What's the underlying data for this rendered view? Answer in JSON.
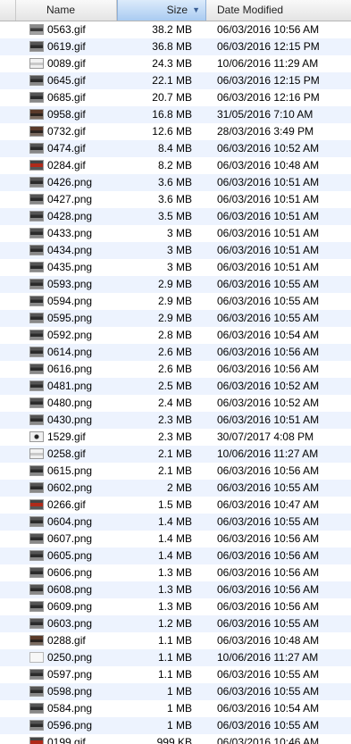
{
  "columns": {
    "name": "Name",
    "size": "Size",
    "date": "Date Modified",
    "sort_indicator": "▼"
  },
  "files": [
    {
      "name": "0563.gif",
      "size": "38.2 MB",
      "date": "06/03/2016 10:56 AM",
      "thumb": "mid"
    },
    {
      "name": "0619.gif",
      "size": "36.8 MB",
      "date": "06/03/2016 12:15 PM",
      "thumb": "dark"
    },
    {
      "name": "0089.gif",
      "size": "24.3 MB",
      "date": "10/06/2016 11:29 AM",
      "thumb": "light"
    },
    {
      "name": "0645.gif",
      "size": "22.1 MB",
      "date": "06/03/2016 12:15 PM",
      "thumb": "dark"
    },
    {
      "name": "0685.gif",
      "size": "20.7 MB",
      "date": "06/03/2016 12:16 PM",
      "thumb": "dark"
    },
    {
      "name": "0958.gif",
      "size": "16.8 MB",
      "date": "31/05/2016 7:10 AM",
      "thumb": "brown"
    },
    {
      "name": "0732.gif",
      "size": "12.6 MB",
      "date": "28/03/2016 3:49 PM",
      "thumb": "brown"
    },
    {
      "name": "0474.gif",
      "size": "8.4 MB",
      "date": "06/03/2016 10:52 AM",
      "thumb": "dark"
    },
    {
      "name": "0284.gif",
      "size": "8.2 MB",
      "date": "06/03/2016 10:48 AM",
      "thumb": "red"
    },
    {
      "name": "0426.png",
      "size": "3.6 MB",
      "date": "06/03/2016 10:51 AM",
      "thumb": "dark"
    },
    {
      "name": "0427.png",
      "size": "3.6 MB",
      "date": "06/03/2016 10:51 AM",
      "thumb": "dark"
    },
    {
      "name": "0428.png",
      "size": "3.5 MB",
      "date": "06/03/2016 10:51 AM",
      "thumb": "dark"
    },
    {
      "name": "0433.png",
      "size": "3 MB",
      "date": "06/03/2016 10:51 AM",
      "thumb": "dark"
    },
    {
      "name": "0434.png",
      "size": "3 MB",
      "date": "06/03/2016 10:51 AM",
      "thumb": "dark"
    },
    {
      "name": "0435.png",
      "size": "3 MB",
      "date": "06/03/2016 10:51 AM",
      "thumb": "dark"
    },
    {
      "name": "0593.png",
      "size": "2.9 MB",
      "date": "06/03/2016 10:55 AM",
      "thumb": "dark"
    },
    {
      "name": "0594.png",
      "size": "2.9 MB",
      "date": "06/03/2016 10:55 AM",
      "thumb": "dark"
    },
    {
      "name": "0595.png",
      "size": "2.9 MB",
      "date": "06/03/2016 10:55 AM",
      "thumb": "dark"
    },
    {
      "name": "0592.png",
      "size": "2.8 MB",
      "date": "06/03/2016 10:54 AM",
      "thumb": "dark"
    },
    {
      "name": "0614.png",
      "size": "2.6 MB",
      "date": "06/03/2016 10:56 AM",
      "thumb": "dark"
    },
    {
      "name": "0616.png",
      "size": "2.6 MB",
      "date": "06/03/2016 10:56 AM",
      "thumb": "dark"
    },
    {
      "name": "0481.png",
      "size": "2.5 MB",
      "date": "06/03/2016 10:52 AM",
      "thumb": "dark"
    },
    {
      "name": "0480.png",
      "size": "2.4 MB",
      "date": "06/03/2016 10:52 AM",
      "thumb": "dark"
    },
    {
      "name": "0430.png",
      "size": "2.3 MB",
      "date": "06/03/2016 10:51 AM",
      "thumb": "dark"
    },
    {
      "name": "1529.gif",
      "size": "2.3 MB",
      "date": "30/07/2017 4:08 PM",
      "thumb": "dot"
    },
    {
      "name": "0258.gif",
      "size": "2.1 MB",
      "date": "10/06/2016 11:27 AM",
      "thumb": "light"
    },
    {
      "name": "0615.png",
      "size": "2.1 MB",
      "date": "06/03/2016 10:56 AM",
      "thumb": "dark"
    },
    {
      "name": "0602.png",
      "size": "2 MB",
      "date": "06/03/2016 10:55 AM",
      "thumb": "dark"
    },
    {
      "name": "0266.gif",
      "size": "1.5 MB",
      "date": "06/03/2016 10:47 AM",
      "thumb": "red"
    },
    {
      "name": "0604.png",
      "size": "1.4 MB",
      "date": "06/03/2016 10:55 AM",
      "thumb": "dark"
    },
    {
      "name": "0607.png",
      "size": "1.4 MB",
      "date": "06/03/2016 10:56 AM",
      "thumb": "dark"
    },
    {
      "name": "0605.png",
      "size": "1.4 MB",
      "date": "06/03/2016 10:56 AM",
      "thumb": "dark"
    },
    {
      "name": "0606.png",
      "size": "1.3 MB",
      "date": "06/03/2016 10:56 AM",
      "thumb": "dark"
    },
    {
      "name": "0608.png",
      "size": "1.3 MB",
      "date": "06/03/2016 10:56 AM",
      "thumb": "dark"
    },
    {
      "name": "0609.png",
      "size": "1.3 MB",
      "date": "06/03/2016 10:56 AM",
      "thumb": "dark"
    },
    {
      "name": "0603.png",
      "size": "1.2 MB",
      "date": "06/03/2016 10:55 AM",
      "thumb": "dark"
    },
    {
      "name": "0288.gif",
      "size": "1.1 MB",
      "date": "06/03/2016 10:48 AM",
      "thumb": "brown"
    },
    {
      "name": "0250.png",
      "size": "1.1 MB",
      "date": "10/06/2016 11:27 AM",
      "thumb": "page"
    },
    {
      "name": "0597.png",
      "size": "1.1 MB",
      "date": "06/03/2016 10:55 AM",
      "thumb": "dark"
    },
    {
      "name": "0598.png",
      "size": "1 MB",
      "date": "06/03/2016 10:55 AM",
      "thumb": "dark"
    },
    {
      "name": "0584.png",
      "size": "1 MB",
      "date": "06/03/2016 10:54 AM",
      "thumb": "dark"
    },
    {
      "name": "0596.png",
      "size": "1 MB",
      "date": "06/03/2016 10:55 AM",
      "thumb": "dark"
    },
    {
      "name": "0199.gif",
      "size": "999 KB",
      "date": "06/03/2016 10:46 AM",
      "thumb": "red"
    }
  ]
}
